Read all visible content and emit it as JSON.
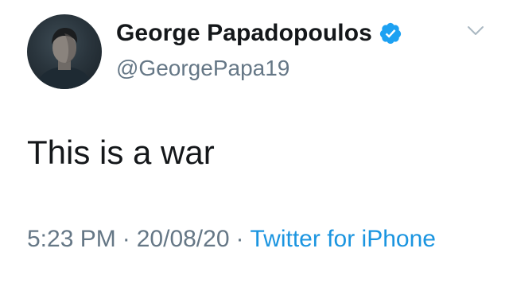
{
  "tweet": {
    "display_name": "George Papadopoulos",
    "handle": "@GeorgePapa19",
    "text": "This is a war",
    "time": "5:23 PM",
    "date": "20/08/20",
    "separator": "·",
    "source": "Twitter for iPhone"
  },
  "icons": {
    "verified": "verified-badge-icon",
    "menu": "chevron-down-icon",
    "avatar": "profile-photo"
  },
  "colors": {
    "text_primary": "#14171a",
    "text_secondary": "#657786",
    "link": "#1b95e0",
    "verified": "#1da1f2"
  }
}
